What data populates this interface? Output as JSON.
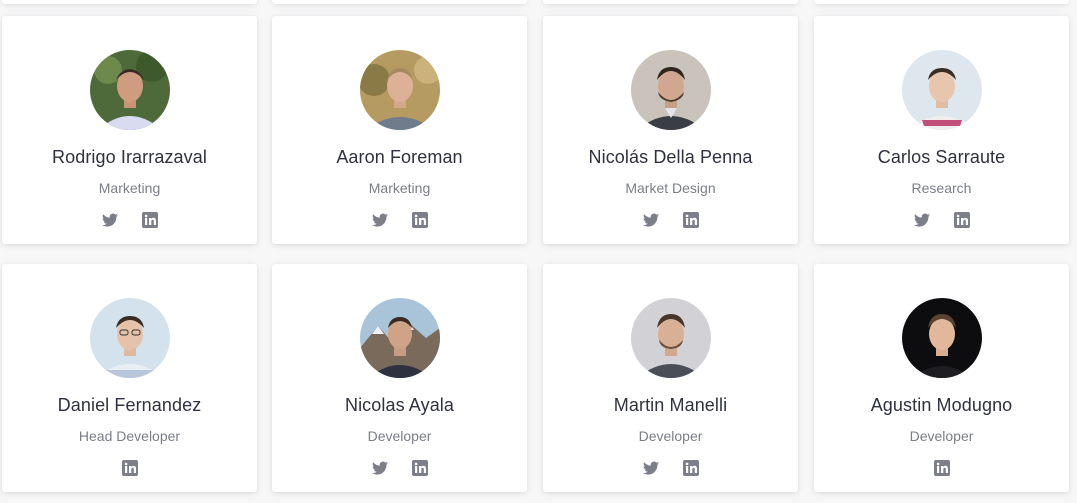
{
  "team": [
    {
      "name": "Rodrigo Irarrazaval",
      "role": "Marketing",
      "socials": [
        "twitter",
        "linkedin"
      ]
    },
    {
      "name": "Aaron Foreman",
      "role": "Marketing",
      "socials": [
        "twitter",
        "linkedin"
      ]
    },
    {
      "name": "Nicolás Della Penna",
      "role": "Market Design",
      "socials": [
        "twitter",
        "linkedin"
      ]
    },
    {
      "name": "Carlos Sarraute",
      "role": "Research",
      "socials": [
        "twitter",
        "linkedin"
      ]
    },
    {
      "name": "Daniel Fernandez",
      "role": "Head Developer",
      "socials": [
        "linkedin"
      ]
    },
    {
      "name": "Nicolas Ayala",
      "role": "Developer",
      "socials": [
        "twitter",
        "linkedin"
      ]
    },
    {
      "name": "Martin Manelli",
      "role": "Developer",
      "socials": [
        "twitter",
        "linkedin"
      ]
    },
    {
      "name": "Agustin Modugno",
      "role": "Developer",
      "socials": [
        "linkedin"
      ]
    }
  ],
  "colors": {
    "icon": "#7c7e8a",
    "name": "#2f3140",
    "role": "#7b7d88",
    "card_bg": "#ffffff",
    "page_bg": "#f7f7f8"
  }
}
